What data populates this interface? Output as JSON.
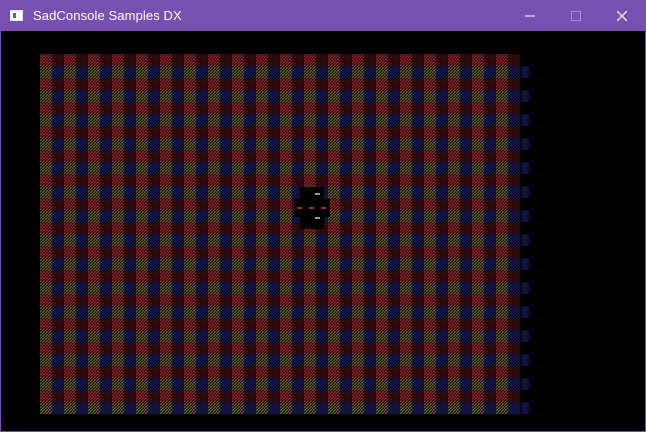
{
  "window": {
    "title": "SadConsole Samples DX",
    "titlebar_color": "#7851b0",
    "icon": "app-window-icon",
    "controls": {
      "minimize_icon": "minimize-icon",
      "maximize_icon": "maximize-icon",
      "maximize_enabled": false,
      "close_icon": "close-icon"
    }
  },
  "console": {
    "background": "#000000",
    "pattern": "plaid",
    "colors": {
      "red": "#a0262c",
      "red_dark": "#5a1418",
      "navy": "#12124a",
      "olive": "#5e5a2a",
      "cursor_dash": "#c02020",
      "cursor_marker": "#9a9a9a"
    }
  }
}
